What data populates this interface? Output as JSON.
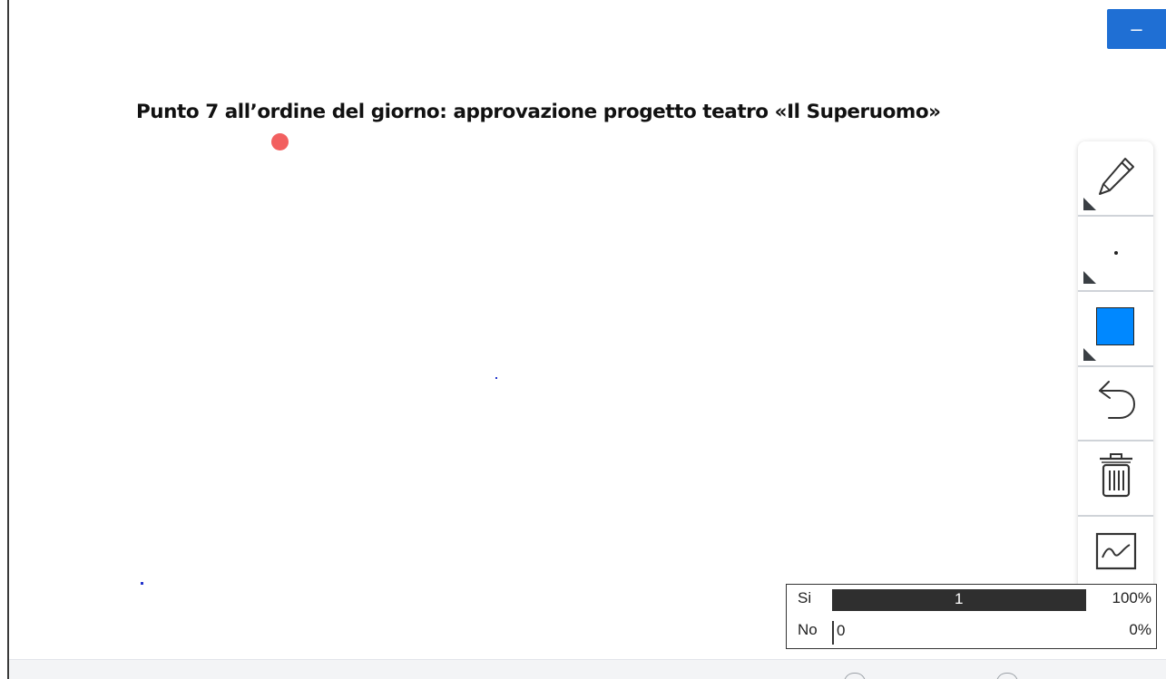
{
  "header": {
    "minimize_label": "–"
  },
  "title": "Punto 7 all’ordine del giorno: approvazione progetto teatro «Il Superuomo»",
  "toolbar": {
    "tools": [
      {
        "name": "pencil",
        "icon": "pencil-icon"
      },
      {
        "name": "brush-size",
        "icon": "dot-icon"
      },
      {
        "name": "color",
        "icon": "color-swatch-icon",
        "color": "#0088ff"
      },
      {
        "name": "undo",
        "icon": "undo-icon"
      },
      {
        "name": "clear",
        "icon": "trash-icon"
      },
      {
        "name": "chart",
        "icon": "line-chart-icon"
      }
    ]
  },
  "results": {
    "rows": [
      {
        "label": "Si",
        "count": "1",
        "percent": "100%",
        "fraction": 1.0
      },
      {
        "label": "No",
        "count": "0",
        "percent": "0%",
        "fraction": 0.0
      }
    ]
  },
  "colors": {
    "accent": "#1f6fd4",
    "pointer": "#f26060",
    "stroke": "#2233cc",
    "bar": "#2f2f2f"
  }
}
